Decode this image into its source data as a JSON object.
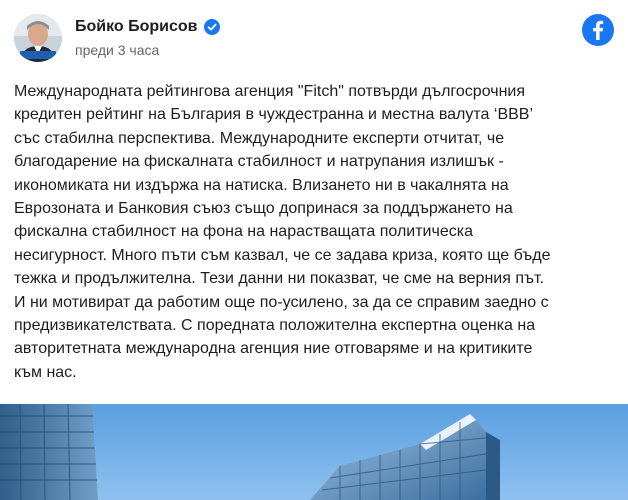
{
  "post": {
    "author_name": "Бойко Борисов",
    "verified": true,
    "timestamp": "преди 3 часа",
    "avatar_caption": "Boyko Borissov",
    "platform_icon": "facebook-icon",
    "body_lines": [
      "Международната рейтингова агенция \"Fitch\" потвърди дългосрочния",
      "кредитен рейтинг на България в чуждестранна и местна валута ‘BBB’",
      "със стабилна перспектива. Международните експерти отчитат, че",
      "благодарение на фискалната стабилност и натрупания излишък -",
      "икономиката ни издържа на натиска. Влизането ни в чакалнята на",
      "Еврозоната и Банковия съюз също допринася за поддържането на",
      "фискална стабилност на фона на нарастващата политическа",
      "несигурност. Много пъти съм казвал, че се задава криза, която ще бъде",
      "тежка и продължителна. Тези данни ни показват, че сме на верния път.",
      "И ни мотивират да работим още по-усилено, за да се справим заедно с",
      "предизвикателствата. С поредната положителна експертна оценка на",
      "авторитетната международна агенция ние отговаряме и на критиките",
      "към нас."
    ],
    "image_subject": "glass office building against blue sky"
  },
  "colors": {
    "facebook_blue": "#1877f2",
    "author_text": "#1c1e21",
    "meta_text": "#65676b"
  }
}
